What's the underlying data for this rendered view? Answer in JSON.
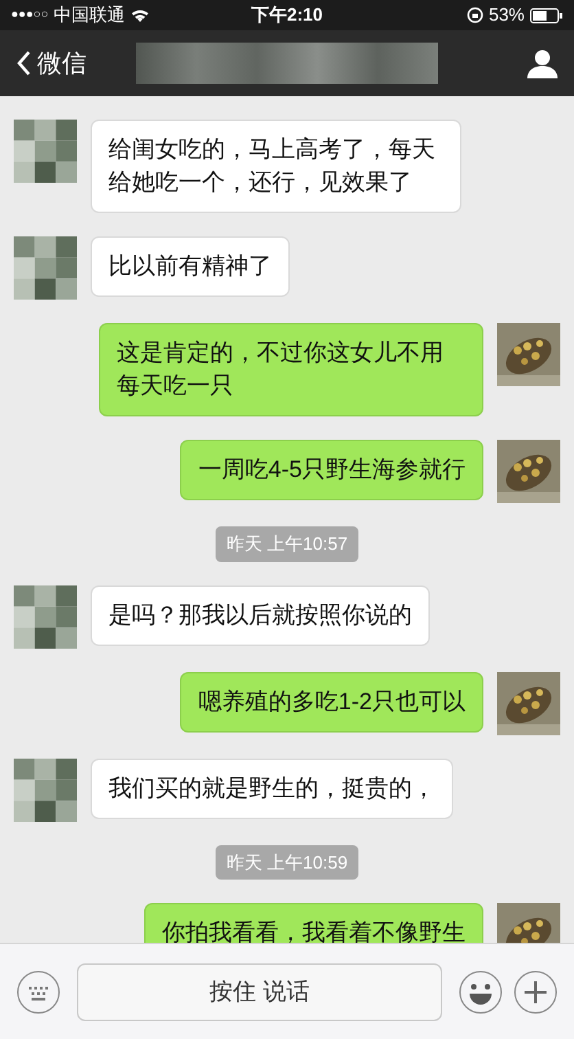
{
  "status_bar": {
    "signal": "●●●○○",
    "carrier": "中国联通",
    "time": "下午2:10",
    "battery": "53%"
  },
  "nav_bar": {
    "back_label": "微信"
  },
  "messages": [
    {
      "kind": "incoming",
      "text": "给闺女吃的，马上高考了，每天给她吃一个，还行，见效果了"
    },
    {
      "kind": "incoming",
      "text": "比以前有精神了"
    },
    {
      "kind": "outgoing",
      "text": "这是肯定的，不过你这女儿不用每天吃一只"
    },
    {
      "kind": "outgoing",
      "text": "一周吃4-5只野生海参就行"
    },
    {
      "kind": "timestamp",
      "text": "昨天 上午10:57"
    },
    {
      "kind": "incoming",
      "text": "是吗？那我以后就按照你说的"
    },
    {
      "kind": "outgoing",
      "text": "嗯养殖的多吃1-2只也可以"
    },
    {
      "kind": "incoming",
      "text": "我们买的就是野生的，挺贵的，"
    },
    {
      "kind": "timestamp",
      "text": "昨天 上午10:59"
    },
    {
      "kind": "outgoing",
      "text": "你拍我看看，我看着不像野生"
    }
  ],
  "input_bar": {
    "hold_to_talk": "按住 说话"
  }
}
